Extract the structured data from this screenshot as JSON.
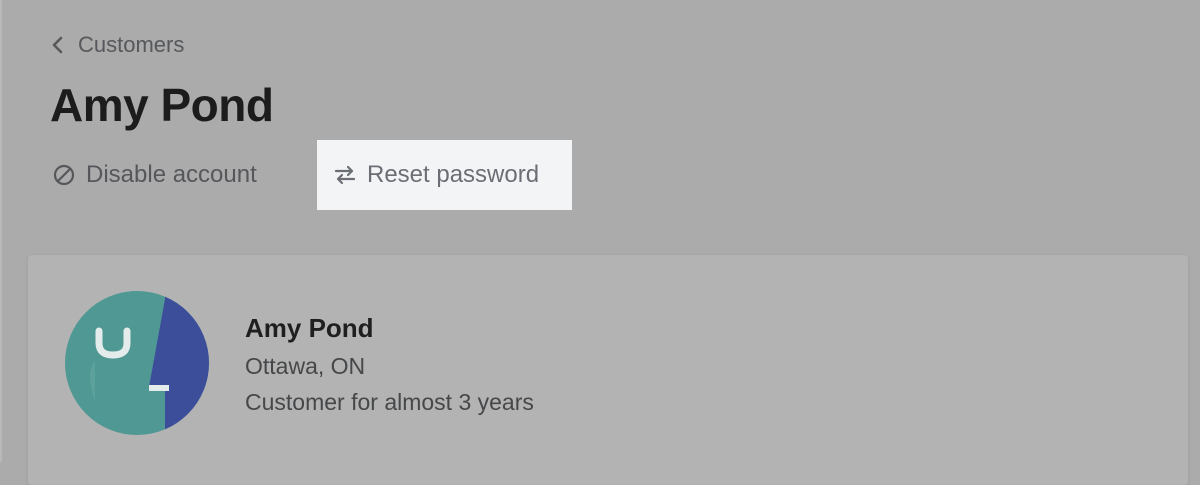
{
  "breadcrumb": {
    "icon": "chevron-left-icon",
    "label": "Customers"
  },
  "page_title": "Amy Pond",
  "actions": {
    "disable": {
      "icon": "circle-slash-icon",
      "label": "Disable account"
    },
    "reset": {
      "icon": "arrows-exchange-icon",
      "label": "Reset password",
      "highlighted": true
    }
  },
  "customer": {
    "name": "Amy Pond",
    "location": "Ottawa, ON",
    "tenure": "Customer for almost 3 years",
    "avatar_icon": "customer-avatar-icon"
  },
  "colors": {
    "overlay_background": "#ababac",
    "highlight_background": "#f3f4f6",
    "avatar_teal": "#4f9893",
    "avatar_indigo": "#3c4d99"
  }
}
